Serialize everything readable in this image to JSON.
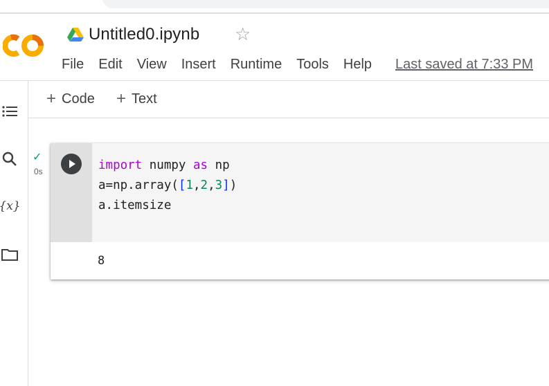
{
  "notebook": {
    "title": "Untitled0.ipynb",
    "last_saved": "Last saved at 7:33 PM"
  },
  "menu": [
    "File",
    "Edit",
    "View",
    "Insert",
    "Runtime",
    "Tools",
    "Help"
  ],
  "toolbar": {
    "code_label": "Code",
    "text_label": "Text"
  },
  "icons": {
    "logo": "colab-logo",
    "drive": "drive-icon",
    "star": "star-icon",
    "sidebar": [
      "toc-icon",
      "search-icon",
      "variables-icon",
      "folder-icon"
    ],
    "run": "play-icon"
  },
  "cell": {
    "exec_time": "0s",
    "status": "✓",
    "code_lines": [
      {
        "parts": [
          {
            "t": "import",
            "c": "kw"
          },
          {
            "t": " numpy ",
            "c": ""
          },
          {
            "t": "as",
            "c": "kw"
          },
          {
            "t": " np",
            "c": ""
          }
        ]
      },
      {
        "parts": [
          {
            "t": "a=np.array(",
            "c": ""
          },
          {
            "t": "[",
            "c": "br"
          },
          {
            "t": "1",
            "c": "num"
          },
          {
            "t": ",",
            "c": ""
          },
          {
            "t": "2",
            "c": "num"
          },
          {
            "t": ",",
            "c": ""
          },
          {
            "t": "3",
            "c": "num"
          },
          {
            "t": "]",
            "c": "br"
          },
          {
            "t": ")",
            "c": ""
          }
        ]
      },
      {
        "parts": [
          {
            "t": "a.itemsize",
            "c": ""
          }
        ]
      }
    ],
    "output": "8"
  },
  "colors": {
    "logo_orange": "#f9ab00",
    "logo_dark": "#e8710a",
    "keyword": "#af00db",
    "number": "#098658",
    "bracket": "#0431fa",
    "check": "#0f9d58"
  }
}
